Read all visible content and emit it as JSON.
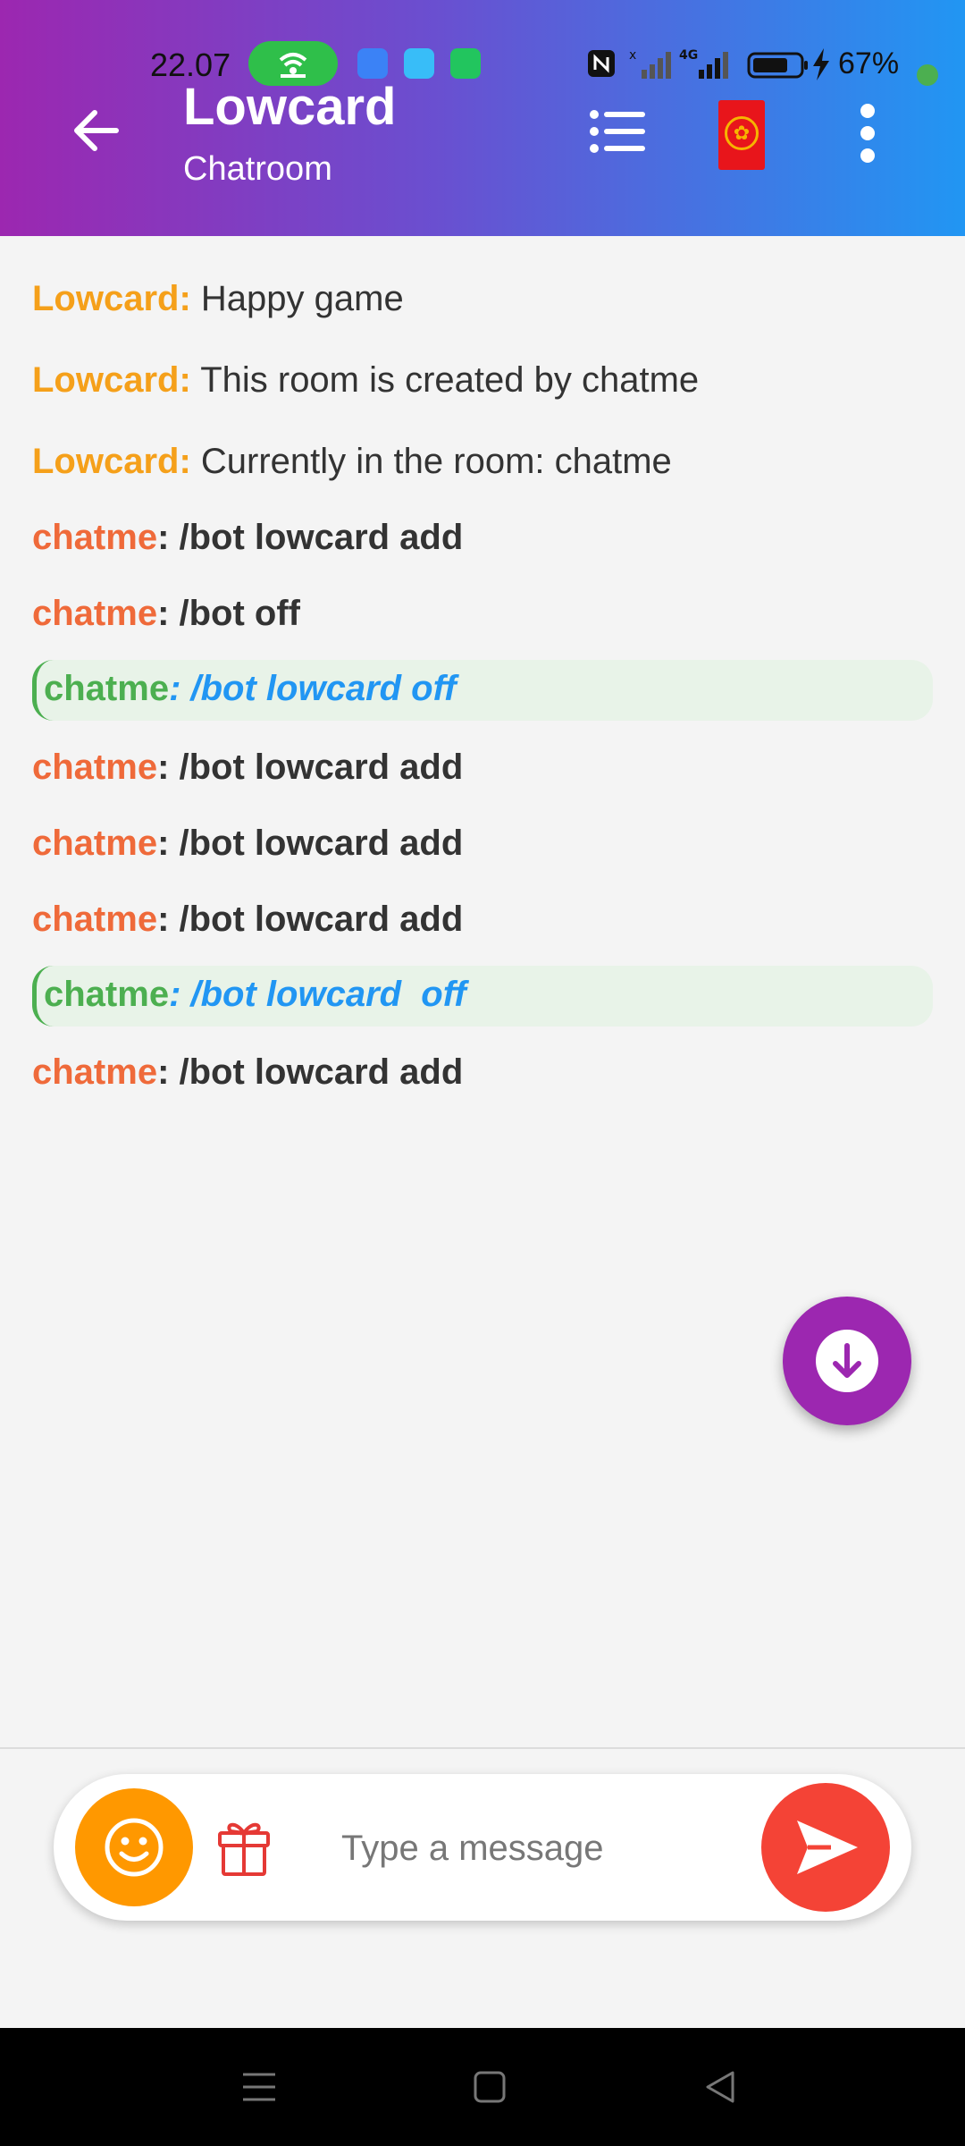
{
  "status_bar": {
    "time": "22.07",
    "battery": "67%",
    "icons": [
      "hotspot-icon",
      "android-notification-icon",
      "cart-notification-icon",
      "phone-notification-icon",
      "nfc-icon",
      "signal-icon",
      "4g-signal-icon",
      "battery-icon",
      "charging-icon"
    ]
  },
  "header": {
    "title": "Lowcard",
    "subtitle": "Chatroom",
    "icons": [
      "back-arrow-icon",
      "list-icon",
      "red-envelope-icon",
      "more-vert-icon"
    ],
    "colors": {
      "gradient_start": "#9c27b0",
      "gradient_end": "#2196f3"
    }
  },
  "messages": [
    {
      "user": "Lowcard:",
      "text": " Happy game",
      "kind": "system"
    },
    {
      "user": "Lowcard:",
      "text": " This room is created by chatme",
      "kind": "system"
    },
    {
      "user": "Lowcard:",
      "text": " Currently in the room: chatme",
      "kind": "system"
    },
    {
      "user": "chatme",
      "text": ": /bot lowcard add",
      "kind": "command"
    },
    {
      "user": "chatme",
      "text": ": /bot off",
      "kind": "command"
    },
    {
      "user": "chatme",
      "text": ": /bot lowcard off",
      "kind": "highlight"
    },
    {
      "user": "chatme",
      "text": ": /bot lowcard add",
      "kind": "command"
    },
    {
      "user": "chatme",
      "text": ": /bot lowcard add",
      "kind": "command"
    },
    {
      "user": "chatme",
      "text": ": /bot lowcard add",
      "kind": "command"
    },
    {
      "user": "chatme",
      "text": ": /bot lowcard  off",
      "kind": "highlight"
    },
    {
      "user": "chatme",
      "text": ": /bot lowcard add",
      "kind": "command"
    }
  ],
  "scroll_button": {
    "icon": "arrow-down-icon",
    "color": "#9c27b0"
  },
  "composer": {
    "placeholder": "Type a message",
    "value": "",
    "icons": [
      "emoji-icon",
      "gift-icon",
      "send-icon"
    ],
    "colors": {
      "emoji": "#ff9800",
      "send": "#f44336"
    }
  },
  "nav_bar": {
    "icons": [
      "menu-nav-icon",
      "home-nav-icon",
      "back-nav-icon"
    ]
  }
}
